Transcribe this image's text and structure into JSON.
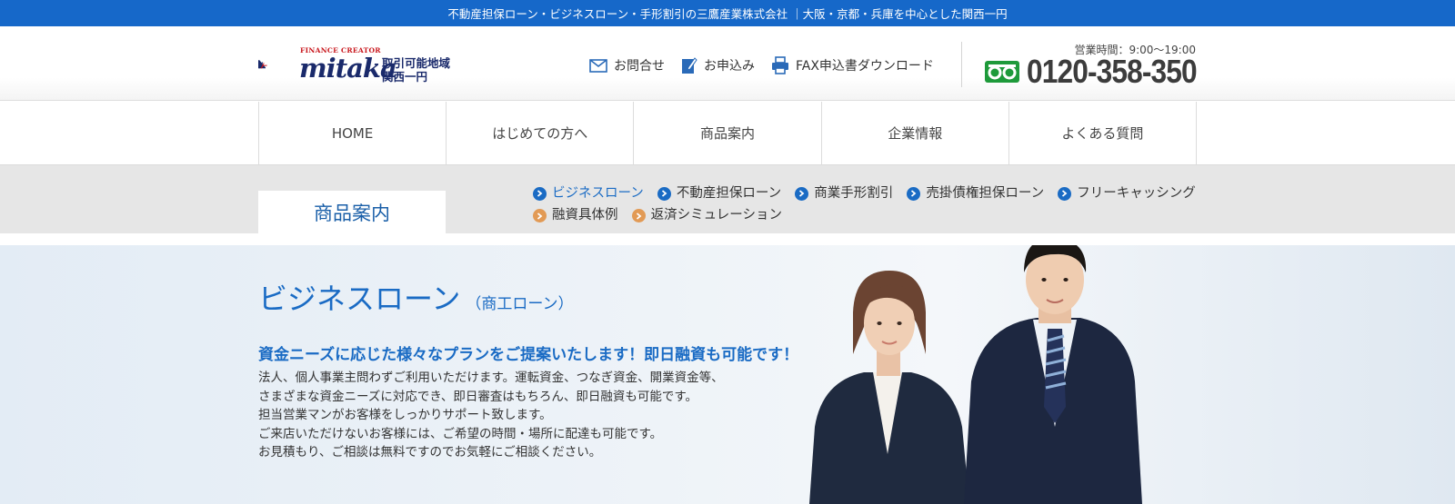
{
  "topbar": {
    "text": "不動産担保ローン・ビジネスローン・手形割引の三鷹産業株式会社 ｜大阪・京都・兵庫を中心とした関西一円"
  },
  "header": {
    "logo": {
      "tagline": "FINANCE CREATOR",
      "word": "mitaka",
      "area_line1": "取引可能地域",
      "area_line2": "関西一円"
    },
    "links": [
      {
        "label": "お問合せ",
        "icon": "mail-icon"
      },
      {
        "label": "お申込み",
        "icon": "pen-form-icon"
      },
      {
        "label": "FAX申込書ダウンロード",
        "icon": "fax-icon"
      }
    ],
    "hours": "営業時間：9:00〜19:00",
    "phone": "0120-358-350",
    "phone_icon": "freedial-icon",
    "colors": {
      "freedial": "#1e9a3a"
    }
  },
  "nav": {
    "items": [
      "HOME",
      "はじめての方へ",
      "商品案内",
      "企業情報",
      "よくある質問"
    ]
  },
  "subnav": {
    "section_title": "商品案内",
    "links": [
      {
        "label": "ビジネスローン",
        "active": true,
        "bullet": "blue"
      },
      {
        "label": "不動産担保ローン",
        "active": false,
        "bullet": "blue"
      },
      {
        "label": "商業手形割引",
        "active": false,
        "bullet": "blue"
      },
      {
        "label": "売掛債権担保ローン",
        "active": false,
        "bullet": "blue"
      },
      {
        "label": "フリーキャッシング",
        "active": false,
        "bullet": "blue"
      },
      {
        "label": "融資具体例",
        "active": false,
        "bullet": "orange"
      },
      {
        "label": "返済シミュレーション",
        "active": false,
        "bullet": "orange"
      }
    ]
  },
  "hero": {
    "title": "ビジネスローン",
    "subtitle": "（商工ローン）",
    "lead": "資金ニーズに応じた様々なプランをご提案いたします！即日融資も可能です！",
    "body": [
      "法人、個人事業主問わずご利用いただけます。運転資金、つなぎ資金、開業資金等、",
      "さまざまな資金ニーズに対応でき、即日審査はもちろん、即日融資も可能です。",
      "担当営業マンがお客様をしっかりサポート致します。",
      "ご来店いただけないお客様には、ご希望の時間・場所に配達も可能です。",
      "お見積もり、ご相談は無料ですのでお気軽にご相談ください。"
    ]
  },
  "colors": {
    "brand_blue": "#1668c9",
    "text_blue": "#1a6bc4",
    "orange_bullet": "#e29a55",
    "logo_navy": "#1a2a6b",
    "logo_red": "#c8151b"
  }
}
